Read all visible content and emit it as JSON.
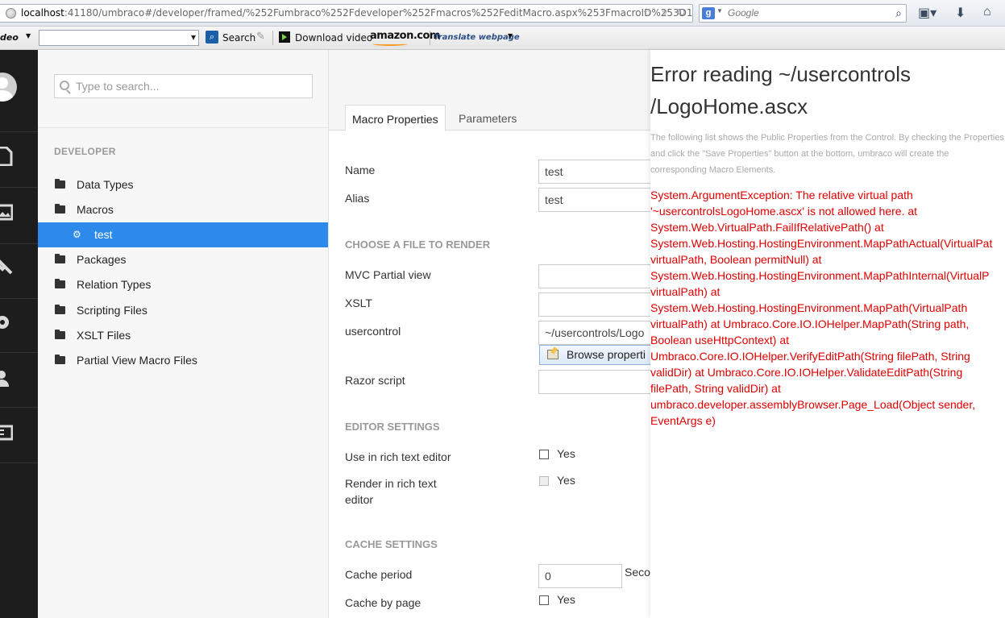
{
  "browser": {
    "url_host": "localhost",
    "url_rest": ":41180/umbraco#/developer/framed/%252Fumbraco%252Fdeveloper%252Fmacros%252FeditMacro.aspx%253FmacroID%253D1",
    "search_engine_letter": "g",
    "search_placeholder": "Google"
  },
  "toolbar": {
    "video_label": "deo",
    "search_label": "Search",
    "download_label": "Download video",
    "amazon_label": "amazon.com",
    "translate_label": "Translate webpage"
  },
  "sidebar": {
    "icons": [
      "content-icon",
      "media-icon",
      "developer-icon",
      "settings-icon",
      "users-icon",
      "members-icon"
    ]
  },
  "tree": {
    "search_placeholder": "Type to search...",
    "header": "DEVELOPER",
    "items": [
      {
        "label": "Data Types"
      },
      {
        "label": "Macros"
      },
      {
        "label": "test"
      },
      {
        "label": "Packages"
      },
      {
        "label": "Relation Types"
      },
      {
        "label": "Scripting Files"
      },
      {
        "label": "XSLT Files"
      },
      {
        "label": "Partial View Macro Files"
      }
    ]
  },
  "editor": {
    "tabs": [
      {
        "label": "Macro Properties"
      },
      {
        "label": "Parameters"
      }
    ],
    "name_label": "Name",
    "name_value": "test",
    "alias_label": "Alias",
    "alias_value": "test",
    "render_section": "CHOOSE A FILE TO RENDER",
    "mvc_label": "MVC Partial view",
    "mvc_value": "",
    "xslt_label": "XSLT",
    "xslt_value": "",
    "usercontrol_label": "usercontrol",
    "usercontrol_value": "~/usercontrols/Logo",
    "browse_label": "Browse properti",
    "razor_label": "Razor script",
    "razor_value": "",
    "editor_section": "EDITOR SETTINGS",
    "rte_label": "Use in rich text editor",
    "rte_option": "Yes",
    "render_rte_label": "Render in rich text editor",
    "render_rte_option": "Yes",
    "cache_section": "CACHE SETTINGS",
    "cache_period_label": "Cache period",
    "cache_period_value": "0",
    "cache_period_suffix": "Secor",
    "cache_page_label": "Cache by page",
    "cache_page_option": "Yes"
  },
  "error": {
    "title": "Error reading ~/usercontrols\n/LogoHome.ascx",
    "description": "The following list shows the Public Properties from the Control. By checking the Properties and click the \"Save Properties\" button at the bottom, umbraco will create the corresponding Macro Elements.",
    "message": "System.ArgumentException: The relative virtual path\n'~usercontrolsLogoHome.ascx' is not allowed here. at\nSystem.Web.VirtualPath.FailIfRelativePath() at\nSystem.Web.Hosting.HostingEnvironment.MapPathActual(VirtualPat\nvirtualPath, Boolean permitNull) at\nSystem.Web.Hosting.HostingEnvironment.MapPathInternal(VirtualP\nvirtualPath) at\nSystem.Web.Hosting.HostingEnvironment.MapPath(VirtualPath\nvirtualPath) at Umbraco.Core.IO.IOHelper.MapPath(String path,\nBoolean useHttpContext) at\nUmbraco.Core.IO.IOHelper.VerifyEditPath(String filePath, String\nvalidDir) at Umbraco.Core.IO.IOHelper.ValidateEditPath(String\nfilePath, String validDir) at\numbraco.developer.assemblyBrowser.Page_Load(Object sender,\nEventArgs e)",
    "color": "#e00000"
  }
}
